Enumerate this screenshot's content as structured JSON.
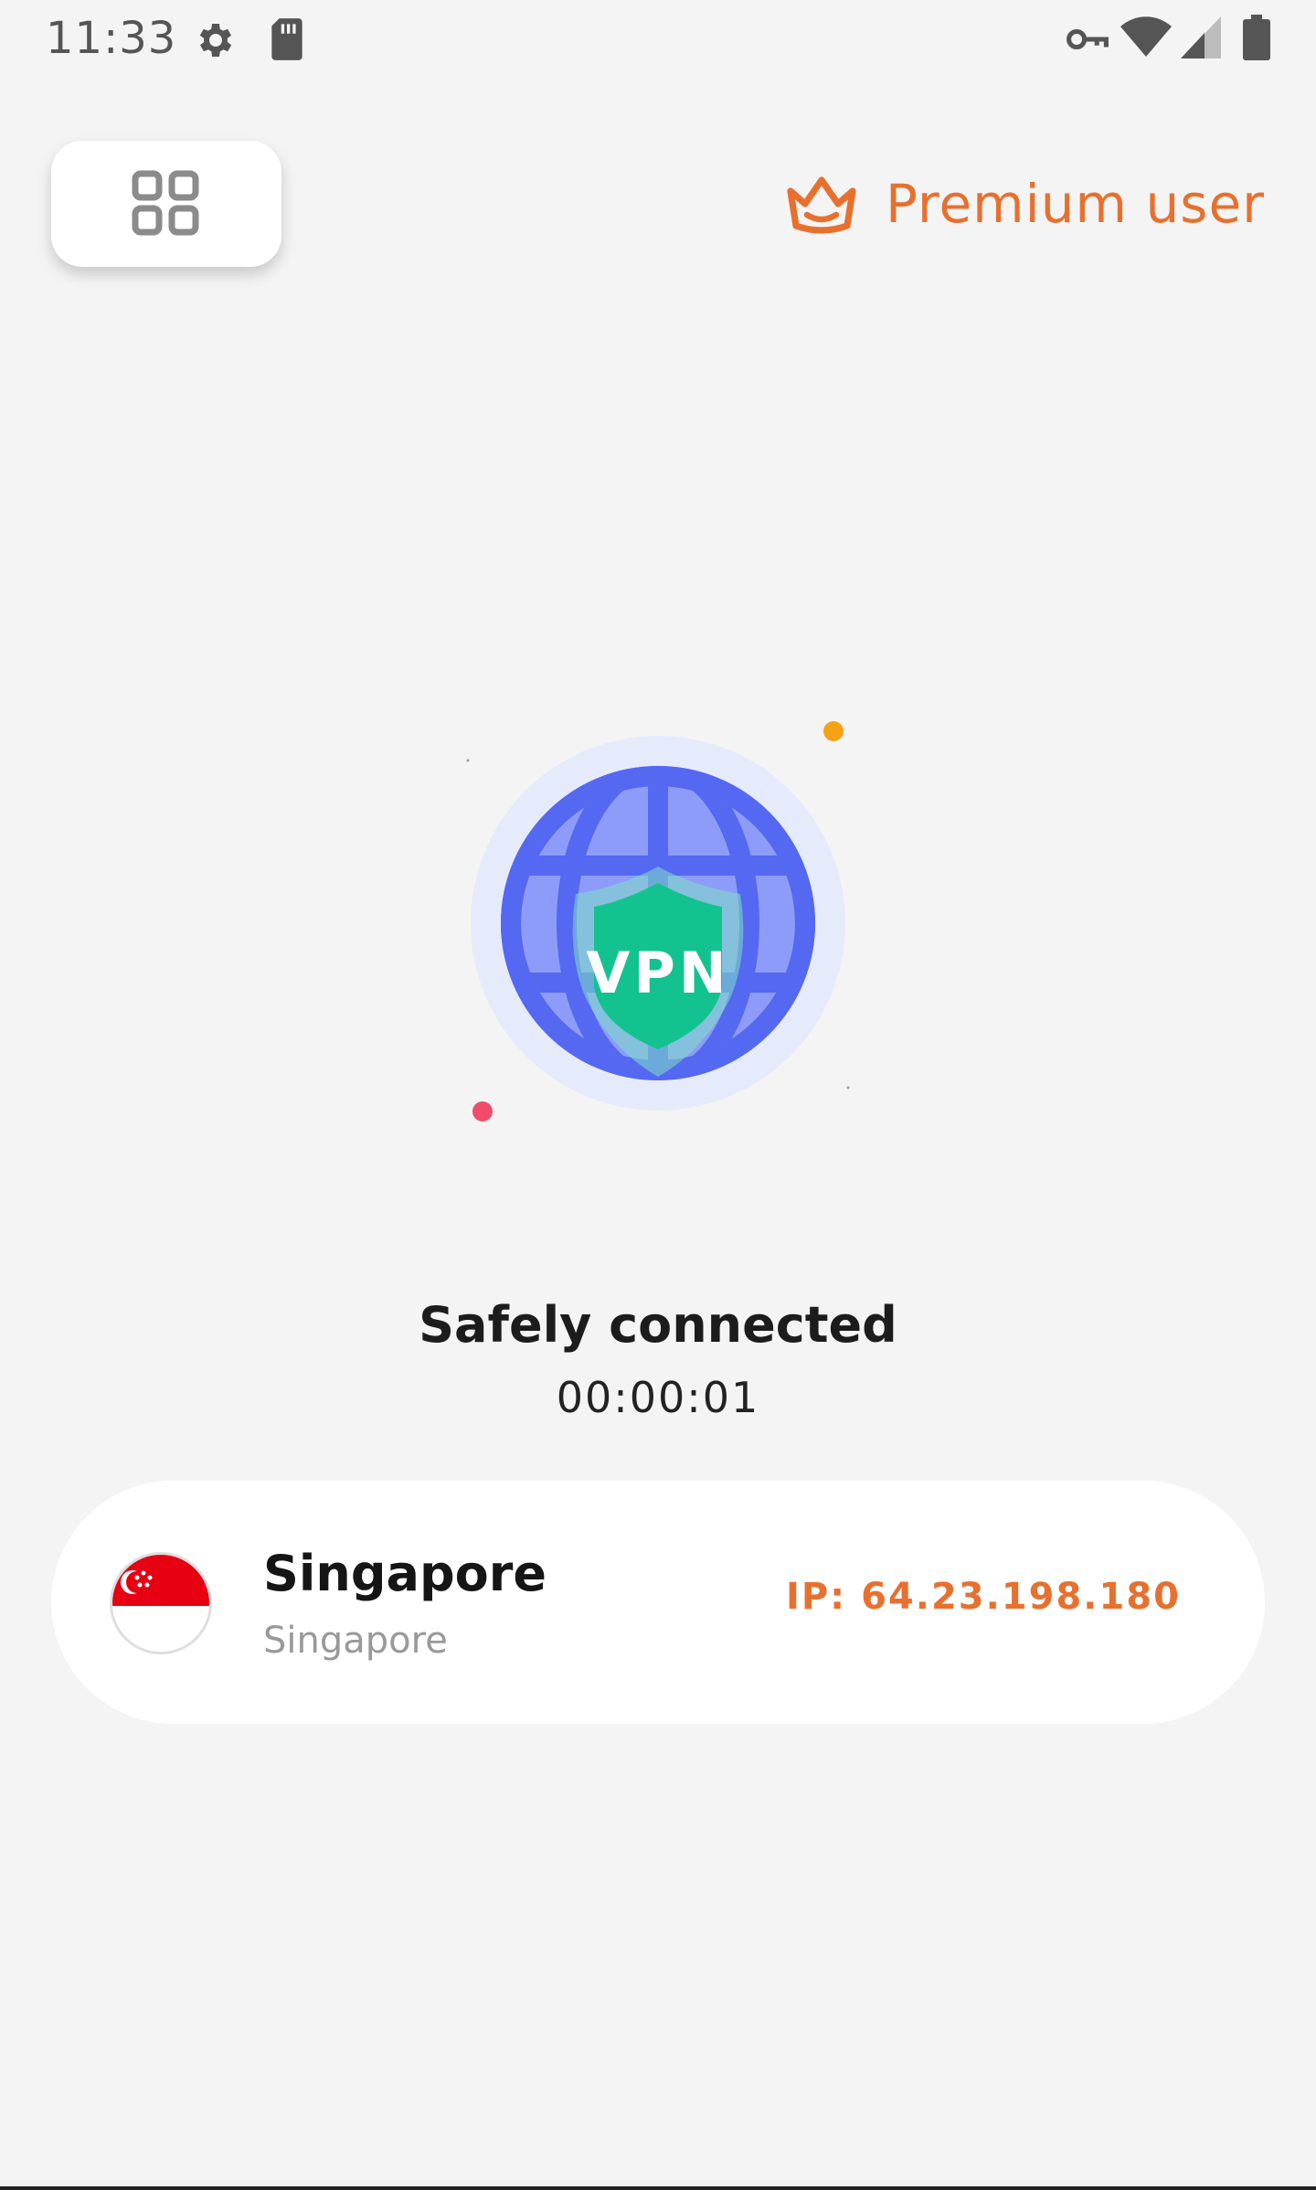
{
  "status_bar": {
    "time": "11:33",
    "icons": [
      "settings-icon",
      "sd-card-icon",
      "vpn-key-icon",
      "wifi-icon",
      "cell-signal-icon",
      "battery-icon"
    ]
  },
  "header": {
    "menu_icon": "grid-icon",
    "premium_icon": "crown-icon",
    "premium_label": "Premium user"
  },
  "illustration": {
    "badge_text": "VPN"
  },
  "connection": {
    "status": "Safely connected",
    "duration": "00:00:01"
  },
  "server": {
    "country": "Singapore",
    "city": "Singapore",
    "ip": "IP: 64.23.198.180",
    "flag_icon": "singapore-flag-icon"
  },
  "colors": {
    "accent": "#e8702e",
    "background": "#f4f4f4",
    "globe": "#5468f2",
    "shield": "#13c38f"
  }
}
